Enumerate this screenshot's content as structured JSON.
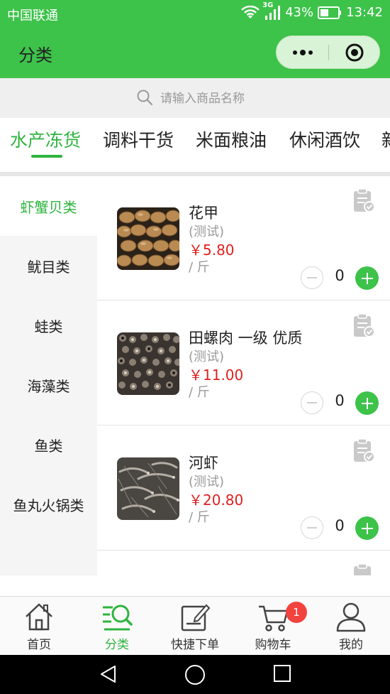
{
  "status_bar": {
    "carrier": "中国联通",
    "network": "3G",
    "battery": "43%",
    "time": "13:42"
  },
  "header": {
    "title": "分类"
  },
  "search": {
    "placeholder": "请输入商品名称"
  },
  "category_tabs": [
    {
      "label": "水产冻货",
      "active": true
    },
    {
      "label": "调料干货",
      "active": false
    },
    {
      "label": "米面粮油",
      "active": false
    },
    {
      "label": "休闲酒饮",
      "active": false
    },
    {
      "label": "新",
      "active": false
    }
  ],
  "sidebar": [
    {
      "label": "虾蟹贝类",
      "active": true
    },
    {
      "label": "鱿目类",
      "active": false
    },
    {
      "label": "蛙类",
      "active": false
    },
    {
      "label": "海藻类",
      "active": false
    },
    {
      "label": "鱼类",
      "active": false
    },
    {
      "label": "鱼丸火锅类",
      "active": false
    }
  ],
  "products": [
    {
      "name": "花甲",
      "note": "(测试)",
      "price": "￥5.80",
      "unit": "/ 斤",
      "qty": "0"
    },
    {
      "name": "田螺肉 一级 优质",
      "note": "(测试)",
      "price": "￥11.00",
      "unit": "/ 斤",
      "qty": "0"
    },
    {
      "name": "河虾",
      "note": "(测试)",
      "price": "￥20.80",
      "unit": "/ 斤",
      "qty": "0"
    }
  ],
  "tabbar": [
    {
      "label": "首页",
      "icon": "home-icon",
      "active": false
    },
    {
      "label": "分类",
      "icon": "category-search-icon",
      "active": true
    },
    {
      "label": "快捷下单",
      "icon": "quick-order-icon",
      "active": false
    },
    {
      "label": "购物车",
      "icon": "cart-icon",
      "active": false
    },
    {
      "label": "我的",
      "icon": "user-icon",
      "active": false
    }
  ],
  "cart_badge": "1",
  "colors": {
    "brand_green": "#3dc24a",
    "price_red": "#e02020",
    "badge_red": "#f2433f"
  }
}
